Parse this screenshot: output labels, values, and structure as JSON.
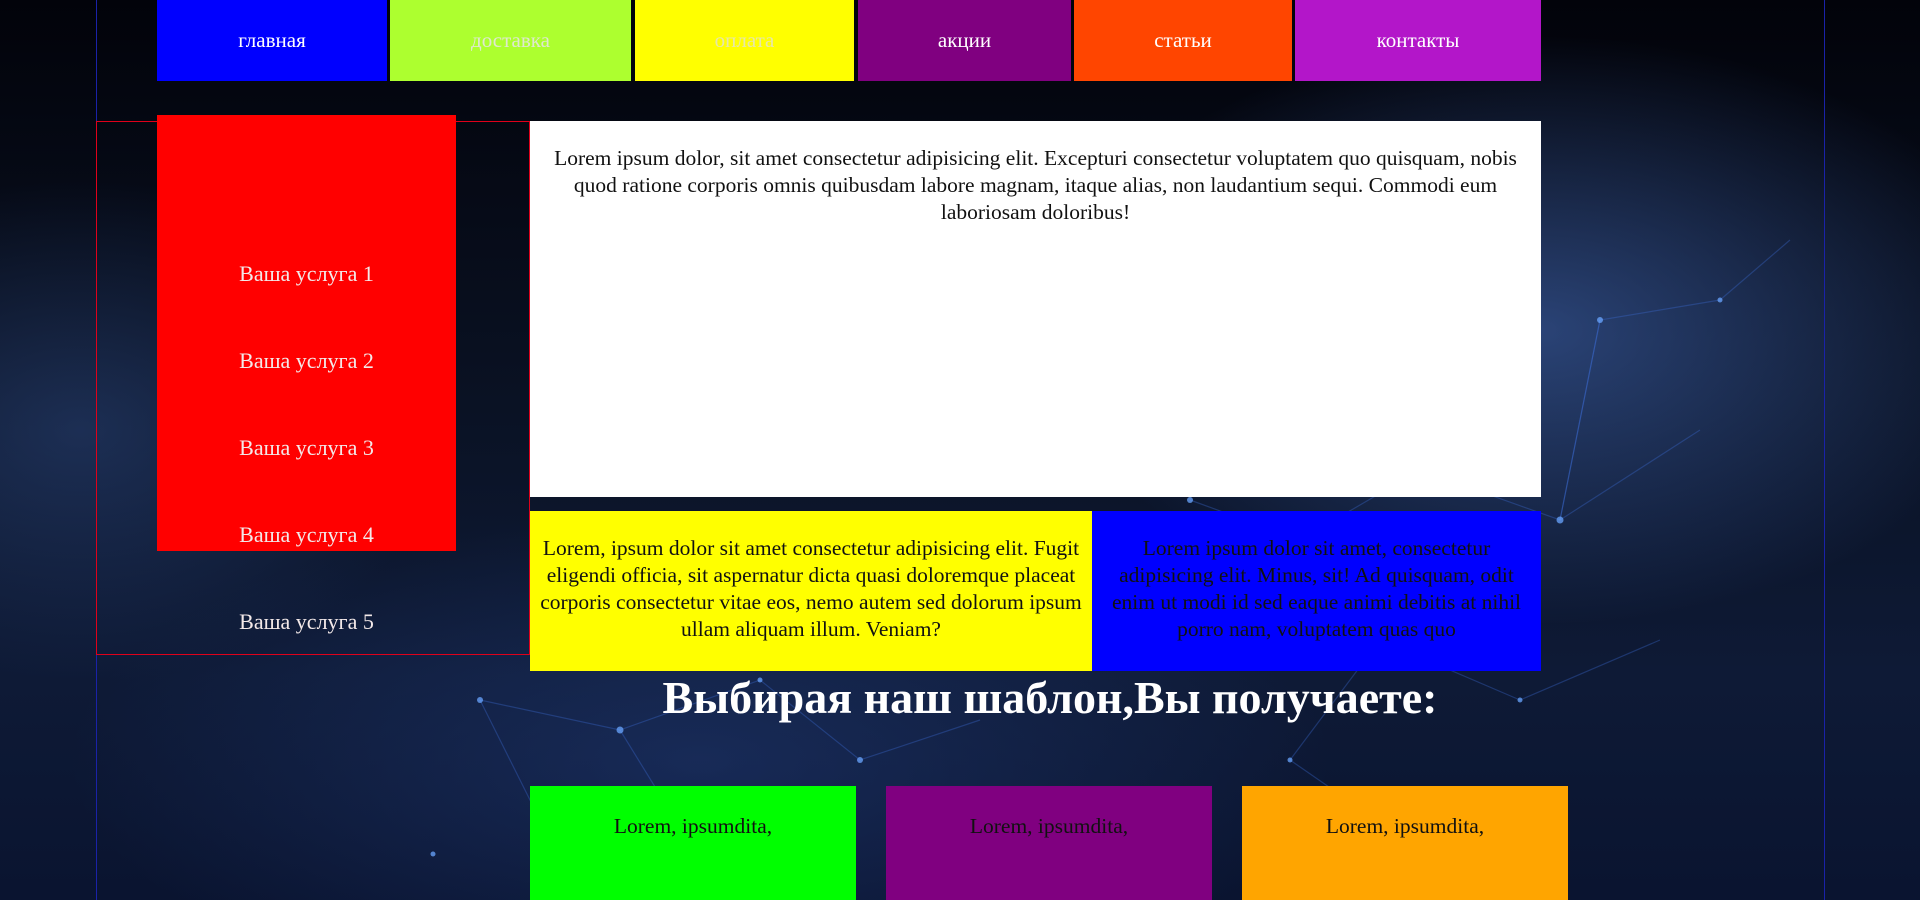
{
  "nav": {
    "items": [
      {
        "label": "главная",
        "bg": "#0000ff",
        "fg": "#ffffff"
      },
      {
        "label": "доставка",
        "bg": "#adff2f",
        "fg": "#dfe8d0"
      },
      {
        "label": "оплата",
        "bg": "#ffff00",
        "fg": "#e7e7a8"
      },
      {
        "label": "акции",
        "bg": "#800080",
        "fg": "#ffffff"
      },
      {
        "label": "статьи",
        "bg": "#ff4500",
        "fg": "#ffffff"
      },
      {
        "label": "контакты",
        "bg": "#b316c9",
        "fg": "#ffffff"
      }
    ]
  },
  "sidebar": {
    "items": [
      {
        "label": "Ваша услуга 1"
      },
      {
        "label": "Ваша услуга 2"
      },
      {
        "label": "Ваша услуга 3"
      },
      {
        "label": "Ваша услуга 4"
      },
      {
        "label": "Ваша услуга 5"
      }
    ]
  },
  "main": {
    "text": "Lorem ipsum dolor, sit amet consectetur adipisicing elit. Excepturi consectetur voluptatem quo quisquam, nobis quod ratione corporis omnis quibusdam labore magnam, itaque alias, non laudantium sequi. Commodi eum laboriosam doloribus!"
  },
  "columns": {
    "yellow_text": "Lorem, ipsum dolor sit amet consectetur adipisicing elit. Fugit eligendi officia, sit aspernatur dicta quasi doloremque placeat corporis consectetur vitae eos, nemo autem sed dolorum ipsum ullam aliquam illum. Veniam?",
    "blue_text": "Lorem ipsum dolor sit amet, consectetur adipisicing elit. Minus, sit! Ad quisquam, odit enim ut modi id sed eaque animi debitis at nihil porro nam, voluptatem quas quo"
  },
  "headline": "Выбирая наш шаблон,Вы получаете:",
  "cards": [
    {
      "label": "Lorem, ipsumdita,",
      "bg": "#00ff00"
    },
    {
      "label": "Lorem, ipsumdita,",
      "bg": "#800080"
    },
    {
      "label": "Lorem, ipsumdita,",
      "bg": "#ffa500"
    }
  ]
}
